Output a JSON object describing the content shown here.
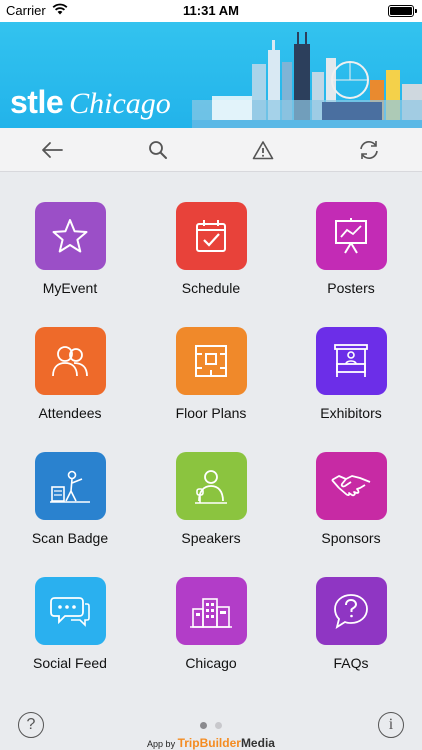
{
  "status": {
    "carrier": "Carrier",
    "time": "11:31 AM",
    "battery_level": 1.0
  },
  "banner": {
    "brand": "stle",
    "city": "Chicago"
  },
  "toolbar": {
    "items": [
      {
        "icon": "back-arrow-icon"
      },
      {
        "icon": "search-icon"
      },
      {
        "icon": "alert-icon"
      },
      {
        "icon": "refresh-icon"
      }
    ]
  },
  "tiles": [
    {
      "label": "MyEvent",
      "icon": "star-icon",
      "color": "#9b4fc7"
    },
    {
      "label": "Schedule",
      "icon": "calendar-check-icon",
      "color": "#e8423a"
    },
    {
      "label": "Posters",
      "icon": "presentation-board-icon",
      "color": "#c32bb5"
    },
    {
      "label": "Attendees",
      "icon": "people-icon",
      "color": "#ee6a2a"
    },
    {
      "label": "Floor Plans",
      "icon": "floor-plan-icon",
      "color": "#f0892a"
    },
    {
      "label": "Exhibitors",
      "icon": "exhibitor-booth-icon",
      "color": "#6c2ee8"
    },
    {
      "label": "Scan Badge",
      "icon": "scan-person-icon",
      "color": "#2a82cf"
    },
    {
      "label": "Speakers",
      "icon": "speaker-icon",
      "color": "#8bc43f"
    },
    {
      "label": "Sponsors",
      "icon": "handshake-icon",
      "color": "#c72aa4"
    },
    {
      "label": "Social Feed",
      "icon": "chat-bubbles-icon",
      "color": "#2ab0ef"
    },
    {
      "label": "Chicago",
      "icon": "city-buildings-icon",
      "color": "#b23dc8"
    },
    {
      "label": "FAQs",
      "icon": "question-bubble-icon",
      "color": "#8f36c3"
    }
  ],
  "footer": {
    "help": "?",
    "info": "i",
    "pager": {
      "pages": 2,
      "active": 1
    },
    "credit_prefix": "App by",
    "credit_brand_a": "TripBuilder",
    "credit_brand_b": "Media"
  }
}
